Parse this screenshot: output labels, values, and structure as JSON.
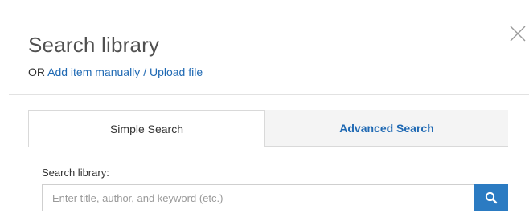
{
  "dialog": {
    "title": "Search library",
    "or_text": "OR",
    "add_item_link": "Add item manually",
    "separator": "/",
    "upload_link": "Upload file"
  },
  "tabs": [
    {
      "label": "Simple Search",
      "active": true
    },
    {
      "label": "Advanced Search",
      "active": false
    }
  ],
  "search": {
    "label": "Search library:",
    "value": "",
    "placeholder": "Enter title, author, and keyword (etc.)"
  },
  "icons": {
    "close": "close-icon",
    "search": "search-icon"
  },
  "colors": {
    "link": "#1f69b3",
    "search_button": "#2b7bc2"
  }
}
